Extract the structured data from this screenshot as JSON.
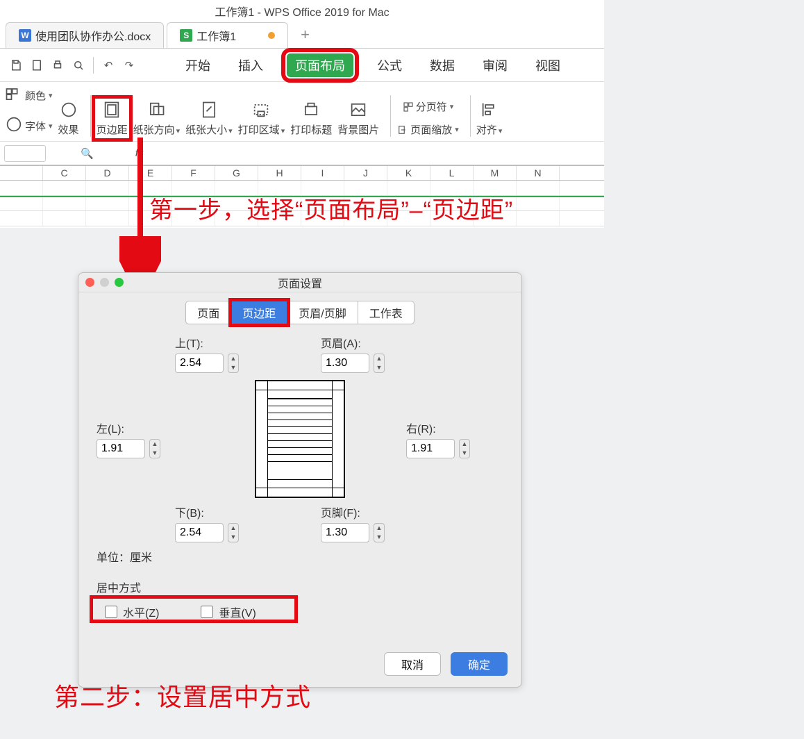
{
  "window": {
    "title": "工作簿1 - WPS Office 2019 for Mac",
    "tabs": [
      {
        "icon": "W",
        "label": "使用团队协作办公.docx"
      },
      {
        "icon": "S",
        "label": "工作簿1"
      }
    ]
  },
  "ribbon": {
    "tabs": [
      "开始",
      "插入",
      "页面布局",
      "公式",
      "数据",
      "审阅",
      "视图"
    ],
    "active": "页面布局",
    "tools": {
      "color": "颜色",
      "font": "字体",
      "effect": "效果",
      "margins": "页边距",
      "orientation": "纸张方向",
      "size": "纸张大小",
      "print_area": "打印区域",
      "print_titles": "打印标题",
      "background": "背景图片",
      "breaks": "分页符",
      "zoom": "页面缩放",
      "align": "对齐"
    }
  },
  "formula_bar": {
    "fx": "fx"
  },
  "columns": [
    "",
    "C",
    "D",
    "E",
    "F",
    "G",
    "H",
    "I",
    "J",
    "K",
    "L",
    "M",
    "N"
  ],
  "annotations": {
    "step1": "第一步，选择“页面布局”–“页边距”",
    "step2": "第二步：设置居中方式"
  },
  "dialog": {
    "title": "页面设置",
    "tabs": [
      "页面",
      "页边距",
      "页眉/页脚",
      "工作表"
    ],
    "active_tab": "页边距",
    "fields": {
      "top_label": "上(T):",
      "top": "2.54",
      "header_label": "页眉(A):",
      "header": "1.30",
      "left_label": "左(L):",
      "left": "1.91",
      "right_label": "右(R):",
      "right": "1.91",
      "bottom_label": "下(B):",
      "bottom": "2.54",
      "footer_label": "页脚(F):",
      "footer": "1.30"
    },
    "unit_label": "单位：厘米",
    "center_label": "居中方式",
    "center_h": "水平(Z)",
    "center_v": "垂直(V)",
    "cancel": "取消",
    "ok": "确定"
  }
}
